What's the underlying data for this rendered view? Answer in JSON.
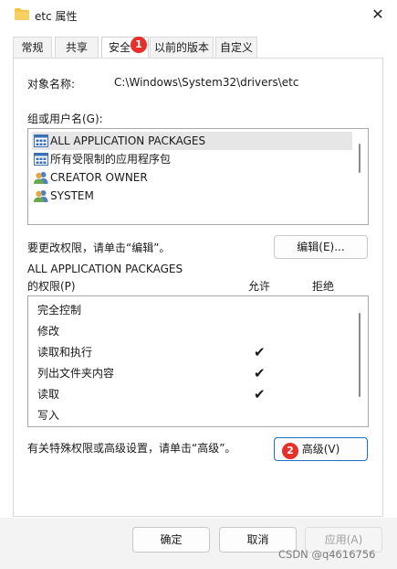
{
  "window": {
    "title": "etc 属性",
    "close_glyph": "✕"
  },
  "tabs": [
    {
      "label": "常规"
    },
    {
      "label": "共享"
    },
    {
      "label": "安全"
    },
    {
      "label": "以前的版本"
    },
    {
      "label": "自定义"
    }
  ],
  "object": {
    "label": "对象名称:",
    "value": "C:\\Windows\\System32\\drivers\\etc"
  },
  "groups": {
    "label": "组或用户名(G):",
    "items": [
      {
        "label": "ALL APPLICATION PACKAGES",
        "icon": "app-packages-icon"
      },
      {
        "label": "所有受限制的应用程序包",
        "icon": "app-packages-icon"
      },
      {
        "label": "CREATOR OWNER",
        "icon": "user-group-icon"
      },
      {
        "label": "SYSTEM",
        "icon": "user-group-icon"
      }
    ]
  },
  "edit": {
    "hint": "要更改权限，请单击“编辑”。",
    "button": "编辑(E)..."
  },
  "permissions": {
    "subject": "ALL APPLICATION PACKAGES",
    "label": "的权限(P)",
    "allow_header": "允许",
    "deny_header": "拒绝",
    "rows": [
      {
        "name": "完全控制",
        "allow": "",
        "deny": ""
      },
      {
        "name": "修改",
        "allow": "",
        "deny": ""
      },
      {
        "name": "读取和执行",
        "allow": "✔",
        "deny": ""
      },
      {
        "name": "列出文件夹内容",
        "allow": "✔",
        "deny": ""
      },
      {
        "name": "读取",
        "allow": "✔",
        "deny": ""
      },
      {
        "name": "写入",
        "allow": "",
        "deny": ""
      }
    ]
  },
  "advanced": {
    "hint": "有关特殊权限或高级设置，请单击“高级”。",
    "button": "高级(V)"
  },
  "annotations": {
    "badge1": "1",
    "badge2": "2"
  },
  "footer": {
    "ok": "确定",
    "cancel": "取消",
    "apply": "应用(A)"
  },
  "watermark": "CSDN @q4616756",
  "colors": {
    "accent": "#1b6fc2",
    "badge": "#e8302a",
    "folder": "#f2c544"
  }
}
